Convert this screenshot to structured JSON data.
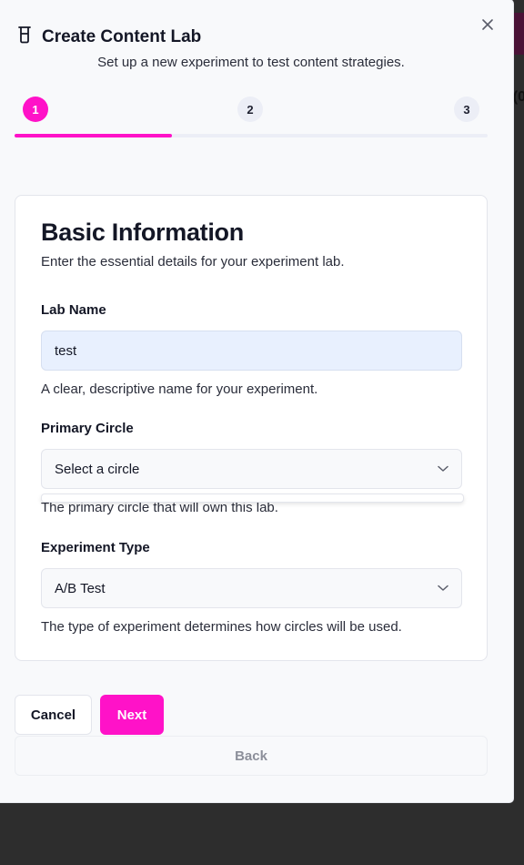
{
  "dialog": {
    "title": "Create Content Lab",
    "subtitle": "Set up a new experiment to test content strategies.",
    "title_icon": "beaker-icon",
    "close_icon": "close-icon"
  },
  "stepper": {
    "steps": [
      {
        "label": "1",
        "state": "active"
      },
      {
        "label": "2",
        "state": "inactive"
      },
      {
        "label": "3",
        "state": "inactive"
      }
    ],
    "progress": 0.333
  },
  "card": {
    "title": "Basic Information",
    "description": "Enter the essential details for your experiment lab.",
    "lab_name": {
      "label": "Lab Name",
      "value": "test",
      "help": "A clear, descriptive name for your experiment."
    },
    "primary_circle": {
      "label": "Primary Circle",
      "value": "Select a circle",
      "help": "The primary circle that will own this lab."
    },
    "experiment_type": {
      "label": "Experiment Type",
      "value": "A/B Test",
      "help": "The type of experiment determines how circles will be used."
    }
  },
  "actions": {
    "cancel": "Cancel",
    "next": "Next",
    "back": "Back"
  },
  "colors": {
    "accent": "#ff12c8",
    "input_bg": "#e8f0fe",
    "track": "#eceef6"
  },
  "backdrop": {
    "glyph": "(0"
  }
}
